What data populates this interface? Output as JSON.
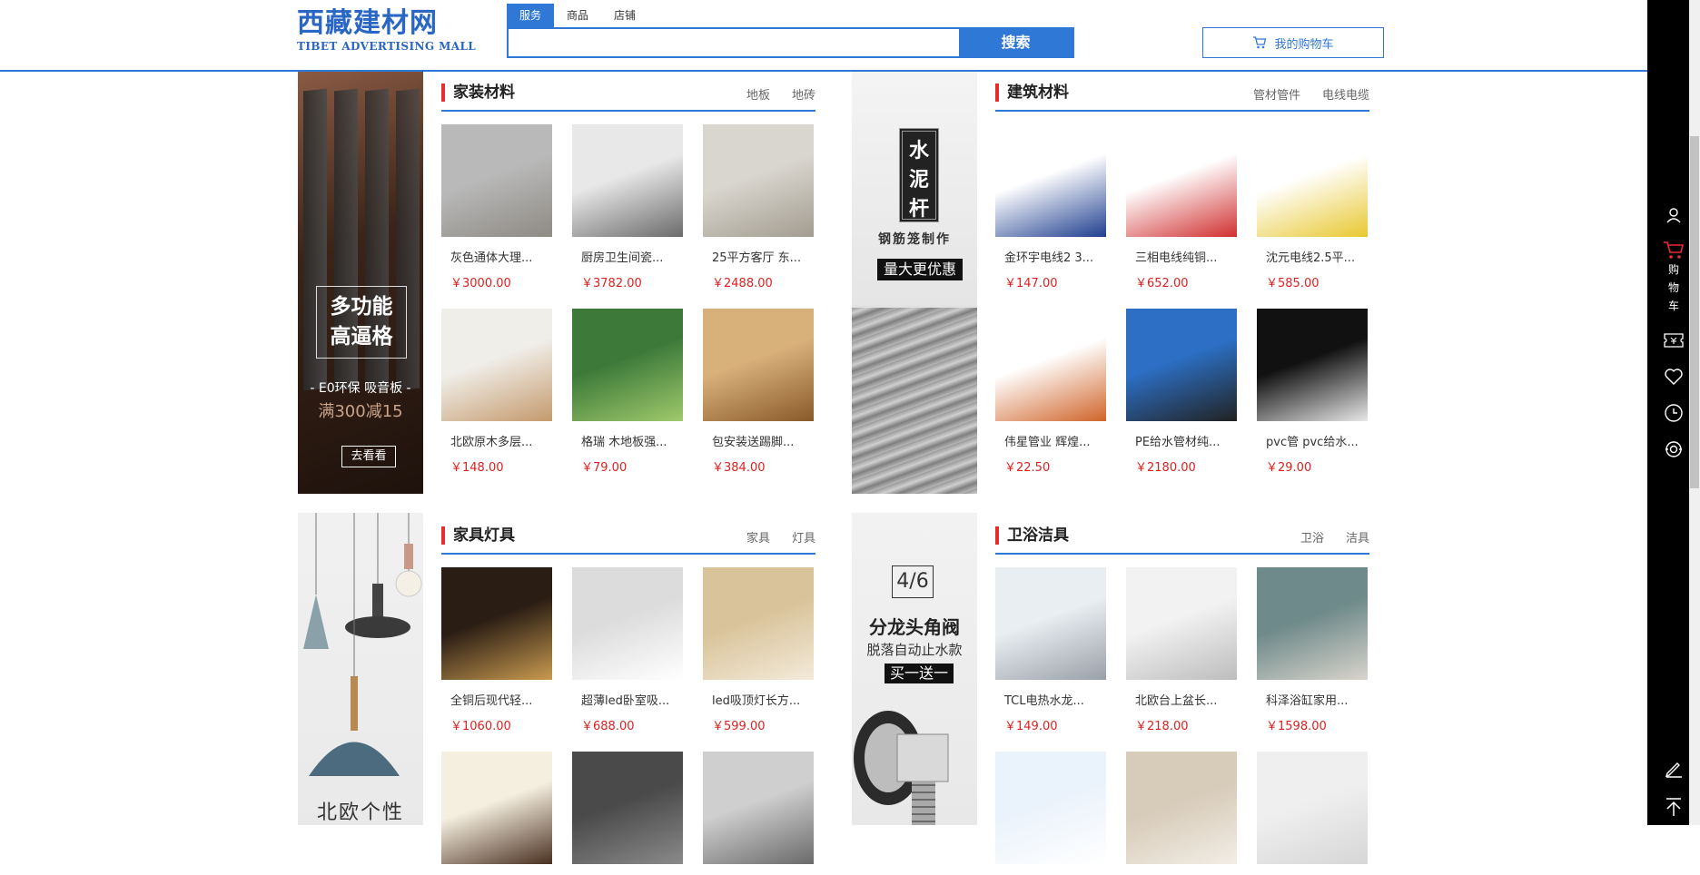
{
  "header": {
    "logo_cn": "西藏建材网",
    "logo_en": "TIBET ADVERTISING MALL",
    "search_tabs": [
      "服务",
      "商品",
      "店铺"
    ],
    "search_placeholder": "",
    "search_button": "搜索",
    "cart_label": "我的购物车"
  },
  "banners": {
    "floor": {
      "line1": "多功能",
      "line2": "高逼格",
      "sub1": "- E0环保 吸音板 -",
      "sub2": "满300减15",
      "button": "去看看"
    },
    "cement": {
      "vertical": [
        "水",
        "泥",
        "杆"
      ],
      "line1": "钢筋笼制作",
      "tag": "量大更优惠"
    },
    "lamp": {
      "caption": "北欧个性"
    },
    "valve": {
      "num": "4/6",
      "title": "分龙头角阀",
      "sub": "脱落自动止水款",
      "tag": "买一送一"
    }
  },
  "sections": [
    {
      "title": "家装材料",
      "links": [
        "地板",
        "地砖"
      ],
      "products": [
        {
          "name": "灰色通体大理...",
          "price": "￥3000.00"
        },
        {
          "name": "厨房卫生间瓷...",
          "price": "￥3782.00"
        },
        {
          "name": "25平方客厅 东...",
          "price": "￥2488.00"
        },
        {
          "name": "北欧原木多层...",
          "price": "￥148.00"
        },
        {
          "name": "格瑞 木地板强...",
          "price": "￥79.00"
        },
        {
          "name": "包安装送踢脚...",
          "price": "￥384.00"
        }
      ]
    },
    {
      "title": "建筑材料",
      "links": [
        "管材管件",
        "电线电缆"
      ],
      "products": [
        {
          "name": "金环宇电线2 3...",
          "price": "￥147.00"
        },
        {
          "name": "三相电线纯铜...",
          "price": "￥652.00"
        },
        {
          "name": "沈元电线2.5平...",
          "price": "￥585.00"
        },
        {
          "name": "伟星管业 辉煌...",
          "price": "￥22.50"
        },
        {
          "name": "PE给水管材纯...",
          "price": "￥2180.00"
        },
        {
          "name": "pvc管 pvc给水...",
          "price": "￥29.00"
        }
      ]
    },
    {
      "title": "家具灯具",
      "links": [
        "家具",
        "灯具"
      ],
      "products": [
        {
          "name": "全铜后现代轻...",
          "price": "￥1060.00"
        },
        {
          "name": "超薄led卧室吸...",
          "price": "￥688.00"
        },
        {
          "name": "led吸顶灯长方...",
          "price": "￥599.00"
        },
        {
          "name": "",
          "price": ""
        },
        {
          "name": "",
          "price": ""
        },
        {
          "name": "",
          "price": ""
        }
      ]
    },
    {
      "title": "卫浴洁具",
      "links": [
        "卫浴",
        "洁具"
      ],
      "products": [
        {
          "name": "TCL电热水龙...",
          "price": "￥149.00"
        },
        {
          "name": "北欧台上盆长...",
          "price": "￥218.00"
        },
        {
          "name": "科泽浴缸家用...",
          "price": "￥1598.00"
        },
        {
          "name": "",
          "price": ""
        },
        {
          "name": "",
          "price": ""
        },
        {
          "name": "",
          "price": ""
        }
      ]
    }
  ],
  "thumbs": [
    [
      "#b9b9b9",
      "#8e8a84"
    ],
    [
      "#e8e8e8",
      "#6b6b6b"
    ],
    [
      "#d9d6cf",
      "#a39d90"
    ],
    [
      "#f0eee9",
      "#c49a6c"
    ],
    [
      "#3d7a3a",
      "#9fc96b"
    ],
    [
      "#d8b07a",
      "#8a5a2a"
    ],
    [
      "#ffffff",
      "#1f3f8f"
    ],
    [
      "#ffffff",
      "#d03030"
    ],
    [
      "#ffffff",
      "#e8c830"
    ],
    [
      "#ffffff",
      "#d0642a"
    ],
    [
      "#2c6fc4",
      "#222222"
    ],
    [
      "#111111",
      "#e8e8e8"
    ],
    [
      "#2a1d14",
      "#c89a50"
    ],
    [
      "#dcdcdc",
      "#ffffff"
    ],
    [
      "#d9c39a",
      "#f3ead9"
    ],
    [
      "#f5efe0",
      "#4a3020"
    ],
    [
      "#4a4a4a",
      "#8a8a8a"
    ],
    [
      "#cfcfcf",
      "#6a6a6a"
    ],
    [
      "#e9eef2",
      "#9aa0a8"
    ],
    [
      "#f2f2f2",
      "#bdbdbd"
    ],
    [
      "#6e8a8a",
      "#d9d4cc"
    ],
    [
      "#eaf2fb",
      "#ffffff"
    ],
    [
      "#d7cbb9",
      "#f2ede5"
    ],
    [
      "#efefef",
      "#d6d6d6"
    ]
  ],
  "rightbar": {
    "cart_chars": [
      "购",
      "物",
      "车"
    ]
  }
}
